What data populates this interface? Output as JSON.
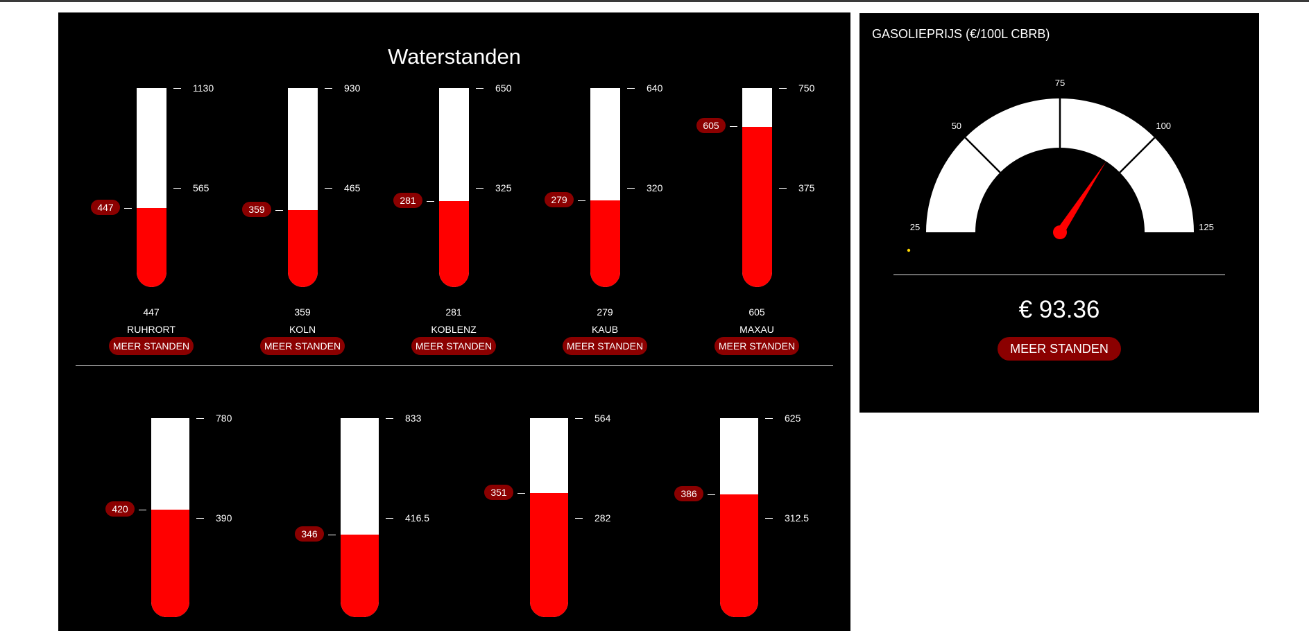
{
  "waterstanden": {
    "title": "Waterstanden",
    "button_label": "MEER STANDEN",
    "row1": [
      {
        "name": "RUHRORT",
        "value": 447,
        "value_text": "447",
        "max": 1130,
        "mid": 565,
        "max_label": "1130",
        "mid_label": "565"
      },
      {
        "name": "KOLN",
        "value": 359,
        "value_text": "359",
        "max": 930,
        "mid": 465,
        "max_label": "930",
        "mid_label": "465"
      },
      {
        "name": "KOBLENZ",
        "value": 281,
        "value_text": "281",
        "max": 650,
        "mid": 325,
        "max_label": "650",
        "mid_label": "325"
      },
      {
        "name": "KAUB",
        "value": 279,
        "value_text": "279",
        "max": 640,
        "mid": 320,
        "max_label": "640",
        "mid_label": "320"
      },
      {
        "name": "MAXAU",
        "value": 605,
        "value_text": "605",
        "max": 750,
        "mid": 375,
        "max_label": "750",
        "mid_label": "375"
      }
    ],
    "row2": [
      {
        "value": 420,
        "value_text": "420",
        "max": 780,
        "mid": 390,
        "max_label": "780",
        "mid_label": "390"
      },
      {
        "value": 346,
        "value_text": "346",
        "max": 833,
        "mid": 416.5,
        "max_label": "833",
        "mid_label": "416.5"
      },
      {
        "value": 351,
        "value_text": "351",
        "max": 564,
        "mid": 282,
        "max_label": "564",
        "mid_label": "282"
      },
      {
        "value": 386,
        "value_text": "386",
        "max": 625,
        "mid": 312.5,
        "max_label": "625",
        "mid_label": "312.5"
      }
    ]
  },
  "gasolie": {
    "title": "GASOLIEPRIJS (€/100L CBRB)",
    "price": "€ 93.36",
    "value": 93.36,
    "min": 25,
    "max": 125,
    "ticks": [
      "25",
      "50",
      "75",
      "100",
      "125"
    ],
    "button_label": "MEER STANDEN"
  },
  "colors": {
    "fill": "#ff0000",
    "badge": "#8b0000",
    "background": "#000000",
    "tube": "#ffffff",
    "dot": "#ffd700"
  }
}
